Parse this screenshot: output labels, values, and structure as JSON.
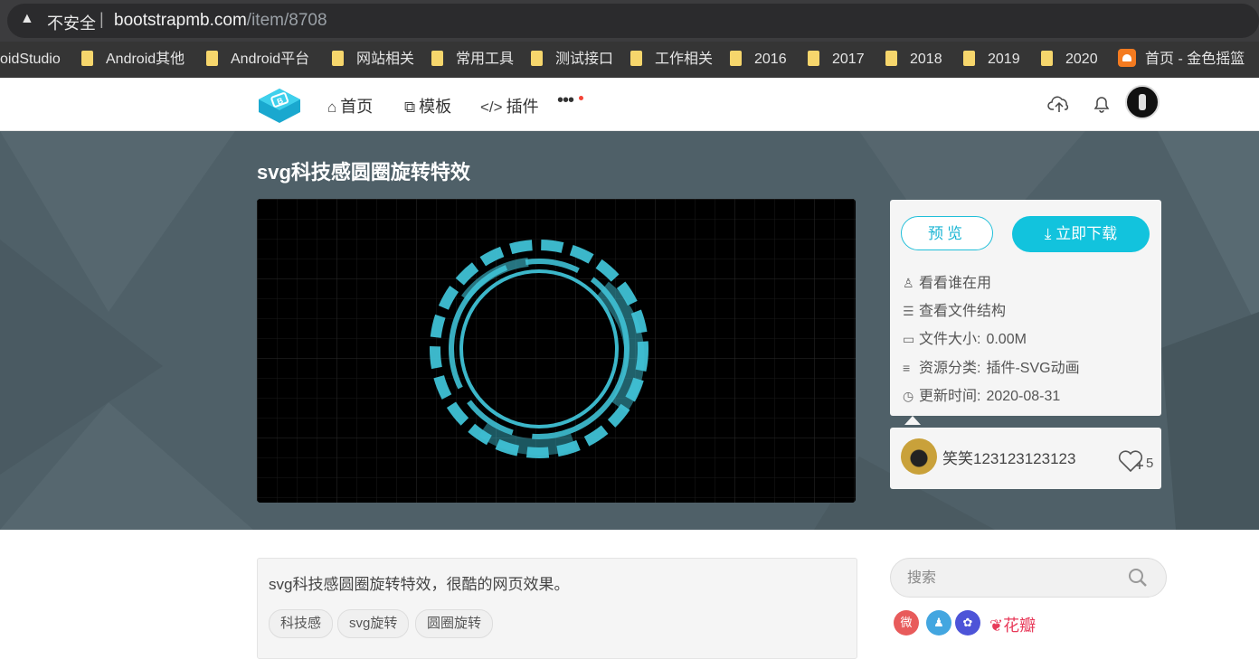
{
  "browser": {
    "warning_icon": "warning-triangle-icon",
    "security_label": "不安全",
    "url_host": "bootstrapmb.com",
    "url_path": "/item/8708"
  },
  "bookmarks": [
    "oidStudio",
    "Android其他",
    "Android平台",
    "网站相关",
    "常用工具",
    "测试接口",
    "工作相关",
    "2016",
    "2017",
    "2018",
    "2019",
    "2020",
    "首页 - 金色摇篮"
  ],
  "nav": {
    "home": "首页",
    "templates": "模板",
    "plugins": "插件",
    "more": "•••"
  },
  "page": {
    "title": "svg科技感圆圈旋转特效"
  },
  "panel": {
    "preview_label": "预览",
    "download_label": "立即下载",
    "who_uses": "看看谁在用",
    "file_structure": "查看文件结构",
    "file_size_label": "文件大小:",
    "file_size_value": "0.00M",
    "category_label": "资源分类:",
    "category_value": "插件-SVG动画",
    "updated_label": "更新时间:",
    "updated_value": "2020-08-31"
  },
  "author": {
    "name": "笑笑123123123123",
    "likes": "5"
  },
  "description": {
    "text": "svg科技感圆圈旋转特效，很酷的网页效果。",
    "tags": [
      "科技感",
      "svg旋转",
      "圆圈旋转"
    ]
  },
  "search": {
    "placeholder": "搜索"
  },
  "share": {
    "huaban": "花瓣"
  },
  "colors": {
    "accent": "#12c3dd",
    "hero_bg": "#4f6068",
    "ring": "#3fc1d5"
  }
}
